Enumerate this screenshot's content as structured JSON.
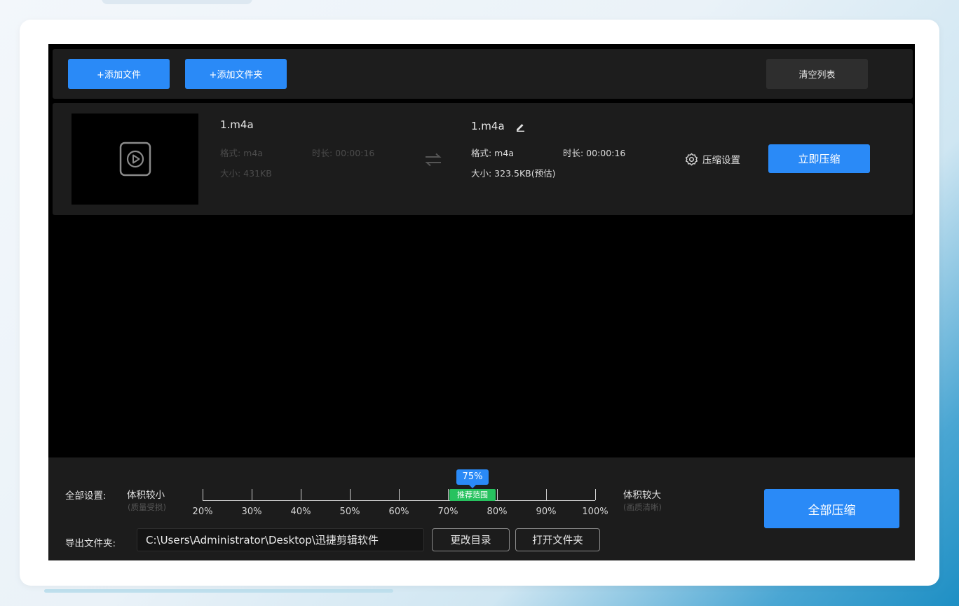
{
  "toolbar": {
    "add_file": "+添加文件",
    "add_folder": "+添加文件夹",
    "clear_list": "清空列表"
  },
  "file": {
    "source": {
      "name": "1.m4a",
      "format": "格式: m4a",
      "duration": "时长: 00:00:16",
      "size": "大小: 431KB"
    },
    "output": {
      "name": "1.m4a",
      "format": "格式: m4a",
      "duration": "时长: 00:00:16",
      "size": "大小: 323.5KB(预估)"
    },
    "settings_label": "压缩设置",
    "compress_now": "立即压缩"
  },
  "global": {
    "label": "全部设置:",
    "small_label": "体积较小",
    "small_sub": "(质量受损)",
    "large_label": "体积较大",
    "large_sub": "(画质清晰)",
    "ticks": [
      "20%",
      "30%",
      "40%",
      "50%",
      "60%",
      "70%",
      "80%",
      "90%",
      "100%"
    ],
    "value": "75%",
    "value_fraction": 0.6875,
    "recommended": "推荐范围",
    "export_label": "导出文件夹:",
    "export_path": "C:\\Users\\Administrator\\Desktop\\迅捷剪辑软件",
    "change_dir": "更改目录",
    "open_folder": "打开文件夹",
    "compress_all": "全部压缩"
  },
  "colors": {
    "accent": "#2a8af7",
    "recommended_green": "#27c25f"
  }
}
